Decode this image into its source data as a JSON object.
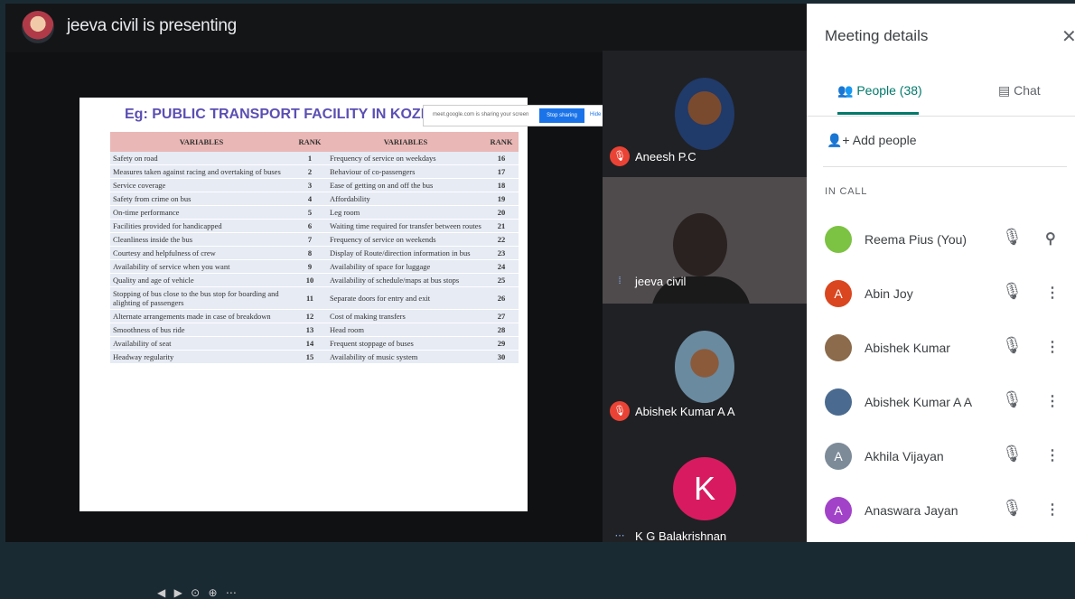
{
  "presenting_text": "jeeva civil is presenting",
  "slide": {
    "title": "Eg: PUBLIC TRANSPORT FACILITY IN KOZHIKODE",
    "headers": [
      "VARIABLES",
      "RANK",
      "VARIABLES",
      "RANK"
    ],
    "rows": [
      [
        "Safety on road",
        "1",
        "Frequency of service on weekdays",
        "16"
      ],
      [
        "Measures taken against racing and overtaking of buses",
        "2",
        "Behaviour of co-passengers",
        "17"
      ],
      [
        "Service coverage",
        "3",
        "Ease of getting on and off the bus",
        "18"
      ],
      [
        "Safety from crime on bus",
        "4",
        "Affordability",
        "19"
      ],
      [
        "On-time performance",
        "5",
        "Leg room",
        "20"
      ],
      [
        "Facilities provided for handicapped",
        "6",
        "Waiting time required for transfer between routes",
        "21"
      ],
      [
        "Cleanliness inside the bus",
        "7",
        "Frequency of service on weekends",
        "22"
      ],
      [
        "Courtesy and helpfulness of crew",
        "8",
        "Display of Route/direction information in bus",
        "23"
      ],
      [
        "Availability of service when you want",
        "9",
        "Availability of space for luggage",
        "24"
      ],
      [
        "Quality and age of vehicle",
        "10",
        "Availability of schedule/maps at bus stops",
        "25"
      ],
      [
        "Stopping of bus close to the bus stop for boarding and alighting of passengers",
        "11",
        "Separate doors for entry and exit",
        "26"
      ],
      [
        "Alternate arrangements made in case of breakdown",
        "12",
        "Cost of making transfers",
        "27"
      ],
      [
        "Smoothness of bus ride",
        "13",
        "Head room",
        "28"
      ],
      [
        "Availability of seat",
        "14",
        "Frequent stoppage of buses",
        "29"
      ],
      [
        "Headway regularity",
        "15",
        "Availability of music system",
        "30"
      ]
    ]
  },
  "share_bar": {
    "url_text": "meet.google.com is sharing your screen",
    "stop_label": "Stop sharing",
    "hide_label": "Hide"
  },
  "tiles": [
    {
      "name": "Aneesh P.C"
    },
    {
      "name": "jeeva civil"
    },
    {
      "name": "Abishek Kumar A A"
    },
    {
      "name": "K G Balakrishnan",
      "initial": "K"
    }
  ],
  "panel": {
    "title": "Meeting details",
    "people_tab": "People (38)",
    "chat_tab": "Chat",
    "add_people": "Add people",
    "in_call": "IN CALL",
    "people": [
      {
        "name": "Reema Pius (You)",
        "initial": "",
        "color": "#7cc243"
      },
      {
        "name": "Abin Joy",
        "initial": "A",
        "color": "#d9461f"
      },
      {
        "name": "Abishek Kumar",
        "initial": "",
        "color": "#8b6b4b"
      },
      {
        "name": "Abishek Kumar A A",
        "initial": "",
        "color": "#4a6a8f"
      },
      {
        "name": "Akhila Vijayan",
        "initial": "A",
        "color": "#7d8b99"
      },
      {
        "name": "Anaswara Jayan",
        "initial": "A",
        "color": "#a142c9"
      }
    ]
  }
}
